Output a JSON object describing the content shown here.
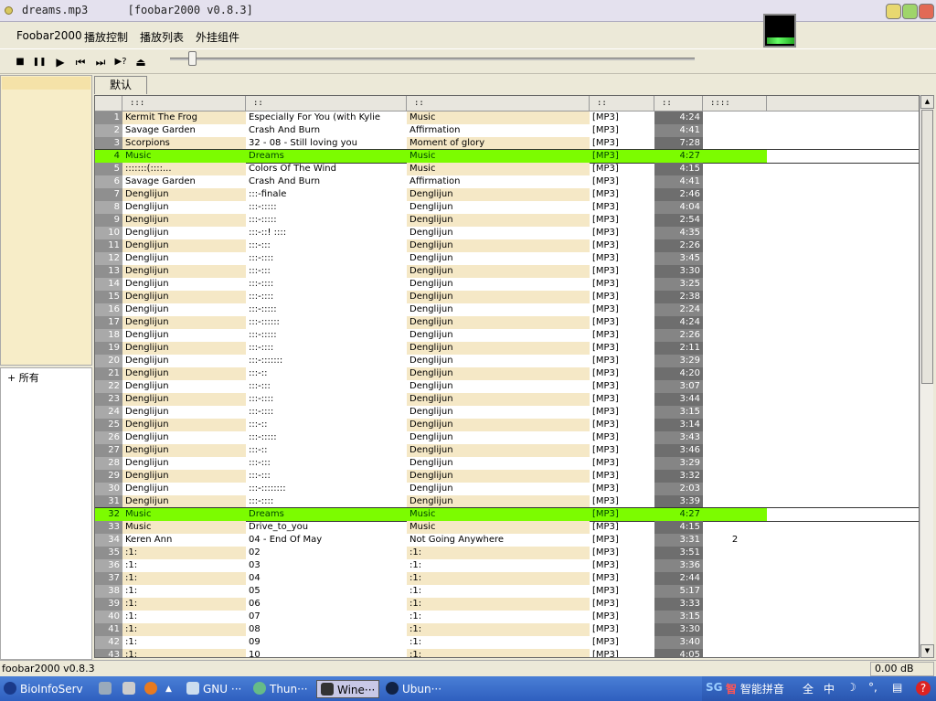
{
  "window": {
    "title": "dreams.mp3      [foobar2000 v0.8.3]"
  },
  "menu": [
    "Foobar2000",
    "播放控制",
    "播放列表",
    "外挂组件"
  ],
  "controls": {
    "stop": "■",
    "pause": "❚❚",
    "play": "▶",
    "prev": "⏮",
    "next": "⏭",
    "random": "▶?",
    "eject": "⏏"
  },
  "combo": {
    "value": "默认"
  },
  "tree": {
    "label": "+   所有"
  },
  "tabs": [
    "默认"
  ],
  "columns": [
    ":::",
    "::",
    "::",
    "::",
    "::",
    "::::"
  ],
  "playlist": [
    {
      "n": "1",
      "artist": "Kermit The Frog",
      "title": "Especially For You (with Kylie",
      "album": "Music",
      "fmt": "[MP3]",
      "dur": "4:24",
      "extra": ""
    },
    {
      "n": "2",
      "artist": "Savage Garden",
      "title": "Crash And Burn",
      "album": "Affirmation",
      "fmt": "[MP3]",
      "dur": "4:41",
      "extra": ""
    },
    {
      "n": "3",
      "artist": "Scorpions",
      "title": "32 - 08 - Still loving you",
      "album": "Moment of glory",
      "fmt": "[MP3]",
      "dur": "7:28",
      "extra": ""
    },
    {
      "n": "4",
      "artist": "Music",
      "title": "Dreams",
      "album": "Music",
      "fmt": "[MP3]",
      "dur": "4:27",
      "extra": "",
      "hl": true
    },
    {
      "n": "5",
      "artist": ":::::::(::::...",
      "title": "Colors Of The Wind",
      "album": "Music",
      "fmt": "[MP3]",
      "dur": "4:15",
      "extra": ""
    },
    {
      "n": "6",
      "artist": "Savage Garden",
      "title": "Crash And Burn",
      "album": "Affirmation",
      "fmt": "[MP3]",
      "dur": "4:41",
      "extra": ""
    },
    {
      "n": "7",
      "artist": "Denglijun",
      "title": ":::-finale",
      "album": "Denglijun",
      "fmt": "[MP3]",
      "dur": "2:46",
      "extra": ""
    },
    {
      "n": "8",
      "artist": "Denglijun",
      "title": ":::-:::::",
      "album": "Denglijun",
      "fmt": "[MP3]",
      "dur": "4:04",
      "extra": ""
    },
    {
      "n": "9",
      "artist": "Denglijun",
      "title": ":::-:::::",
      "album": "Denglijun",
      "fmt": "[MP3]",
      "dur": "2:54",
      "extra": ""
    },
    {
      "n": "10",
      "artist": "Denglijun",
      "title": ":::-::! ::::",
      "album": "Denglijun",
      "fmt": "[MP3]",
      "dur": "4:35",
      "extra": ""
    },
    {
      "n": "11",
      "artist": "Denglijun",
      "title": ":::-:::",
      "album": "Denglijun",
      "fmt": "[MP3]",
      "dur": "2:26",
      "extra": ""
    },
    {
      "n": "12",
      "artist": "Denglijun",
      "title": ":::-::::",
      "album": "Denglijun",
      "fmt": "[MP3]",
      "dur": "3:45",
      "extra": ""
    },
    {
      "n": "13",
      "artist": "Denglijun",
      "title": ":::-:::",
      "album": "Denglijun",
      "fmt": "[MP3]",
      "dur": "3:30",
      "extra": ""
    },
    {
      "n": "14",
      "artist": "Denglijun",
      "title": ":::-::::",
      "album": "Denglijun",
      "fmt": "[MP3]",
      "dur": "3:25",
      "extra": ""
    },
    {
      "n": "15",
      "artist": "Denglijun",
      "title": ":::-::::",
      "album": "Denglijun",
      "fmt": "[MP3]",
      "dur": "2:38",
      "extra": ""
    },
    {
      "n": "16",
      "artist": "Denglijun",
      "title": ":::-:::::",
      "album": "Denglijun",
      "fmt": "[MP3]",
      "dur": "2:24",
      "extra": ""
    },
    {
      "n": "17",
      "artist": "Denglijun",
      "title": ":::-::::::",
      "album": "Denglijun",
      "fmt": "[MP3]",
      "dur": "4:24",
      "extra": ""
    },
    {
      "n": "18",
      "artist": "Denglijun",
      "title": ":::-:::::",
      "album": "Denglijun",
      "fmt": "[MP3]",
      "dur": "2:26",
      "extra": ""
    },
    {
      "n": "19",
      "artist": "Denglijun",
      "title": ":::-::::",
      "album": "Denglijun",
      "fmt": "[MP3]",
      "dur": "2:11",
      "extra": ""
    },
    {
      "n": "20",
      "artist": "Denglijun",
      "title": ":::-:::::::",
      "album": "Denglijun",
      "fmt": "[MP3]",
      "dur": "3:29",
      "extra": ""
    },
    {
      "n": "21",
      "artist": "Denglijun",
      "title": ":::-::",
      "album": "Denglijun",
      "fmt": "[MP3]",
      "dur": "4:20",
      "extra": ""
    },
    {
      "n": "22",
      "artist": "Denglijun",
      "title": ":::-:::",
      "album": "Denglijun",
      "fmt": "[MP3]",
      "dur": "3:07",
      "extra": ""
    },
    {
      "n": "23",
      "artist": "Denglijun",
      "title": ":::-::::",
      "album": "Denglijun",
      "fmt": "[MP3]",
      "dur": "3:44",
      "extra": ""
    },
    {
      "n": "24",
      "artist": "Denglijun",
      "title": ":::-::::",
      "album": "Denglijun",
      "fmt": "[MP3]",
      "dur": "3:15",
      "extra": ""
    },
    {
      "n": "25",
      "artist": "Denglijun",
      "title": ":::-::",
      "album": "Denglijun",
      "fmt": "[MP3]",
      "dur": "3:14",
      "extra": ""
    },
    {
      "n": "26",
      "artist": "Denglijun",
      "title": ":::-:::::",
      "album": "Denglijun",
      "fmt": "[MP3]",
      "dur": "3:43",
      "extra": ""
    },
    {
      "n": "27",
      "artist": "Denglijun",
      "title": ":::-::",
      "album": "Denglijun",
      "fmt": "[MP3]",
      "dur": "3:46",
      "extra": ""
    },
    {
      "n": "28",
      "artist": "Denglijun",
      "title": ":::-:::",
      "album": "Denglijun",
      "fmt": "[MP3]",
      "dur": "3:29",
      "extra": ""
    },
    {
      "n": "29",
      "artist": "Denglijun",
      "title": ":::-:::",
      "album": "Denglijun",
      "fmt": "[MP3]",
      "dur": "3:32",
      "extra": ""
    },
    {
      "n": "30",
      "artist": "Denglijun",
      "title": ":::-::::::::",
      "album": "Denglijun",
      "fmt": "[MP3]",
      "dur": "2:03",
      "extra": ""
    },
    {
      "n": "31",
      "artist": "Denglijun",
      "title": ":::-::::",
      "album": "Denglijun",
      "fmt": "[MP3]",
      "dur": "3:39",
      "extra": ""
    },
    {
      "n": "32",
      "artist": "Music",
      "title": "Dreams",
      "album": "Music",
      "fmt": "[MP3]",
      "dur": "4:27",
      "extra": "",
      "hl": true
    },
    {
      "n": "33",
      "artist": "Music",
      "title": "Drive_to_you",
      "album": "Music",
      "fmt": "[MP3]",
      "dur": "4:15",
      "extra": ""
    },
    {
      "n": "34",
      "artist": "Keren Ann",
      "title": "04 - End Of May",
      "album": "Not Going Anywhere",
      "fmt": "[MP3]",
      "dur": "3:31",
      "extra": "2"
    },
    {
      "n": "35",
      "artist": ":1:",
      "title": "02",
      "album": ":1:",
      "fmt": "[MP3]",
      "dur": "3:51",
      "extra": ""
    },
    {
      "n": "36",
      "artist": ":1:",
      "title": "03",
      "album": ":1:",
      "fmt": "[MP3]",
      "dur": "3:36",
      "extra": ""
    },
    {
      "n": "37",
      "artist": ":1:",
      "title": "04",
      "album": ":1:",
      "fmt": "[MP3]",
      "dur": "2:44",
      "extra": ""
    },
    {
      "n": "38",
      "artist": ":1:",
      "title": "05",
      "album": ":1:",
      "fmt": "[MP3]",
      "dur": "5:17",
      "extra": ""
    },
    {
      "n": "39",
      "artist": ":1:",
      "title": "06",
      "album": ":1:",
      "fmt": "[MP3]",
      "dur": "3:33",
      "extra": ""
    },
    {
      "n": "40",
      "artist": ":1:",
      "title": "07",
      "album": ":1:",
      "fmt": "[MP3]",
      "dur": "3:15",
      "extra": ""
    },
    {
      "n": "41",
      "artist": ":1:",
      "title": "08",
      "album": ":1:",
      "fmt": "[MP3]",
      "dur": "3:30",
      "extra": ""
    },
    {
      "n": "42",
      "artist": ":1:",
      "title": "09",
      "album": ":1:",
      "fmt": "[MP3]",
      "dur": "3:40",
      "extra": ""
    },
    {
      "n": "43",
      "artist": ":1:",
      "title": "10",
      "album": ":1:",
      "fmt": "[MP3]",
      "dur": "4:05",
      "extra": ""
    }
  ],
  "status": {
    "text": "foobar2000 v0.8.3",
    "gain": "0.00 dB"
  },
  "taskbar": {
    "items": [
      "BioInfoServ",
      "GNU ···",
      "Thun···",
      "Wine···",
      "Ubun···"
    ],
    "active": "Wine···",
    "tray": [
      "智能拼音",
      "全",
      "中"
    ]
  },
  "colors": {
    "highlight": "#7cfc00",
    "stripe": "#f5e8c6",
    "taskbar": "#2f5fbf"
  }
}
